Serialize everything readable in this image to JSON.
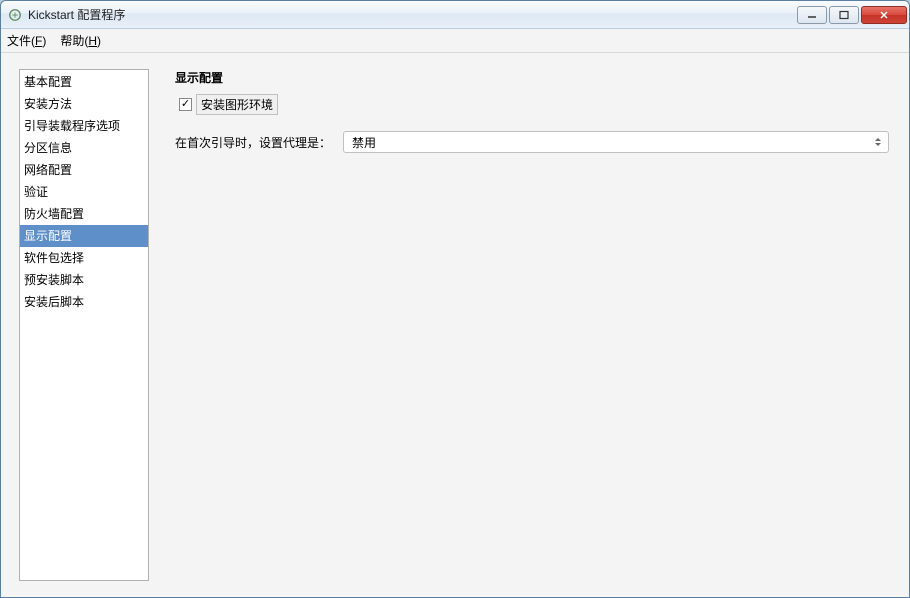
{
  "window": {
    "title": "Kickstart 配置程序"
  },
  "menu": {
    "file": {
      "label": "文件",
      "accel": "F"
    },
    "help": {
      "label": "帮助",
      "accel": "H"
    }
  },
  "sidebar": {
    "items": [
      {
        "label": "基本配置"
      },
      {
        "label": "安装方法"
      },
      {
        "label": "引导装载程序选项"
      },
      {
        "label": "分区信息"
      },
      {
        "label": "网络配置"
      },
      {
        "label": "验证"
      },
      {
        "label": "防火墙配置"
      },
      {
        "label": "显示配置",
        "selected": true
      },
      {
        "label": "软件包选择"
      },
      {
        "label": "预安装脚本"
      },
      {
        "label": "安装后脚本"
      }
    ]
  },
  "main": {
    "section_title": "显示配置",
    "install_gui_checkbox": {
      "checked": true,
      "label": "安装图形环境"
    },
    "agent_row": {
      "label": "在首次引导时，设置代理是：",
      "selected": "禁用"
    }
  }
}
